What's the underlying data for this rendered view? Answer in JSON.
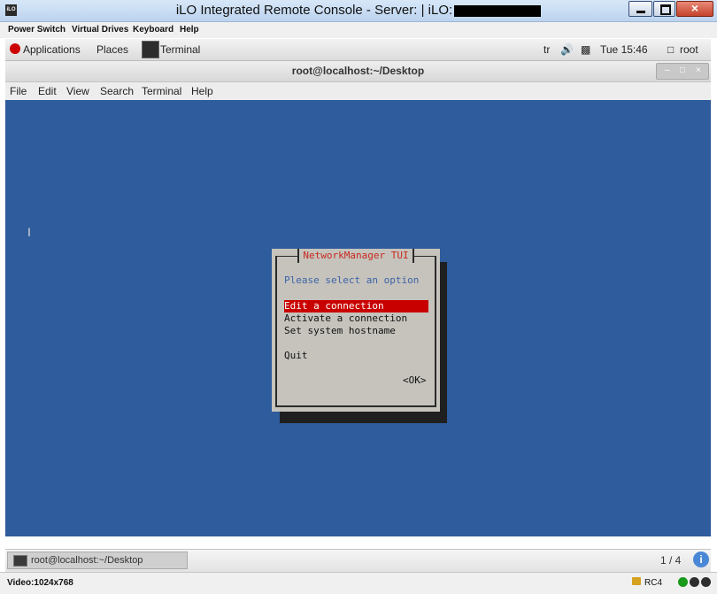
{
  "ilo_window": {
    "title": "iLO Integrated Remote Console - Server:  | iLO:",
    "logo": "iLO",
    "close_glyph": "×",
    "menu": [
      "Power Switch",
      "Virtual Drives",
      "Keyboard",
      "Help"
    ]
  },
  "gnome_panel": {
    "applications": "Applications",
    "places": "Places",
    "task_label": "Terminal",
    "keyboard_layout": "tr",
    "clock": "Tue 15:46",
    "user": "root"
  },
  "terminal_window": {
    "title": "root@localhost:~/Desktop",
    "menu": [
      "File",
      "Edit",
      "View",
      "Search",
      "Terminal",
      "Help"
    ]
  },
  "tui_dialog": {
    "title": "NetworkManager TUI",
    "prompt": "Please select an option",
    "options": [
      "Edit a connection",
      "Activate a connection",
      "Set system hostname",
      "Quit"
    ],
    "selected_index": 0,
    "ok_label": "<OK>"
  },
  "bottom_panel": {
    "task_label": "root@localhost:~/Desktop",
    "workspace": "1 / 4"
  },
  "ilo_status": {
    "video": "Video:1024x768",
    "encryption": "RC4"
  },
  "colors": {
    "terminal_bg": "#2e5c9c",
    "tui_selection": "#c90000",
    "tui_title": "#c8281e",
    "tui_prompt": "#3e63a8"
  },
  "icons": [
    "redhat-icon",
    "volume-icon",
    "network-icon",
    "user-icon",
    "lock-icon",
    "workspace-info-icon"
  ]
}
